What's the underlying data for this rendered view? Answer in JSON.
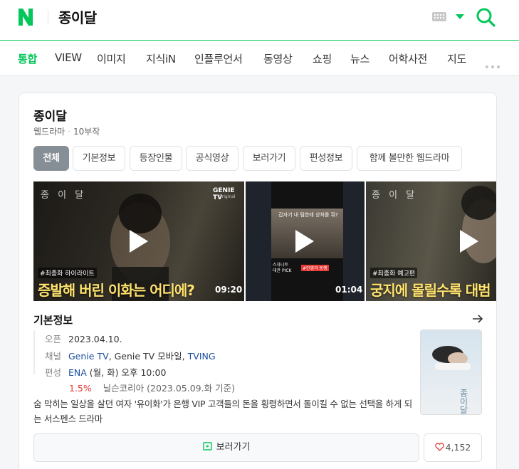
{
  "header": {
    "logo": "N",
    "query": "종이달",
    "keyboard_icon": "keyboard-icon",
    "search_icon": "search-icon"
  },
  "tabs": [
    "통합",
    "VIEW",
    "이미지",
    "지식iN",
    "인플루언서",
    "동영상",
    "쇼핑",
    "뉴스",
    "어학사전",
    "지도"
  ],
  "colors": {
    "accent": "#03c75a",
    "link": "#1a4fa0",
    "rating": "#e53935"
  },
  "card": {
    "title": "종이달",
    "genre": "웹드라마",
    "episodes": "10부작",
    "chips": [
      "전체",
      "기본정보",
      "등장인물",
      "공식영상",
      "보러가기",
      "편성정보",
      "함께 볼만한 웹드라마"
    ],
    "videos": [
      {
        "watermark": "종 이 달",
        "logo": "GENIE TV",
        "logo_sub": "Original",
        "tag": "#최종화 하이라이트",
        "caption": "증발해 버린 이화는 어디에?",
        "duration": "09:20"
      },
      {
        "header": "갑자기 내 팀한테 상처를 줘?",
        "label1": "스자니트",
        "label2": "대관 PICK",
        "label3": "#인영과 동행",
        "duration": "01:04"
      },
      {
        "watermark": "종 이 달",
        "tag": "#최종화 예고편",
        "caption": "궁지에 몰릴수록 대범"
      }
    ],
    "basic_info": {
      "title": "기본정보",
      "open_label": "오픈",
      "open_value": "2023.04.10.",
      "channel_label": "채널",
      "channel_1": "Genie TV",
      "channel_2": "Genie TV 모바일",
      "channel_3": "TVING",
      "schedule_label": "편성",
      "schedule_net": "ENA",
      "schedule_time": "(월, 화) 오후 10:00",
      "rating": "1.5%",
      "rating_source": "닐슨코리아",
      "rating_date": "(2023.05.09.화 기준)"
    },
    "synopsis": "숨 막히는 일상을 살던 여자 '유이화'가 은행 VIP 고객들의 돈을 횡령하면서 돌이킬 수 없는 선택을 하게 되는 서스펜스 드라마",
    "poster_text": "종이달",
    "watch_label": "보러가기",
    "likes": "4,152"
  }
}
